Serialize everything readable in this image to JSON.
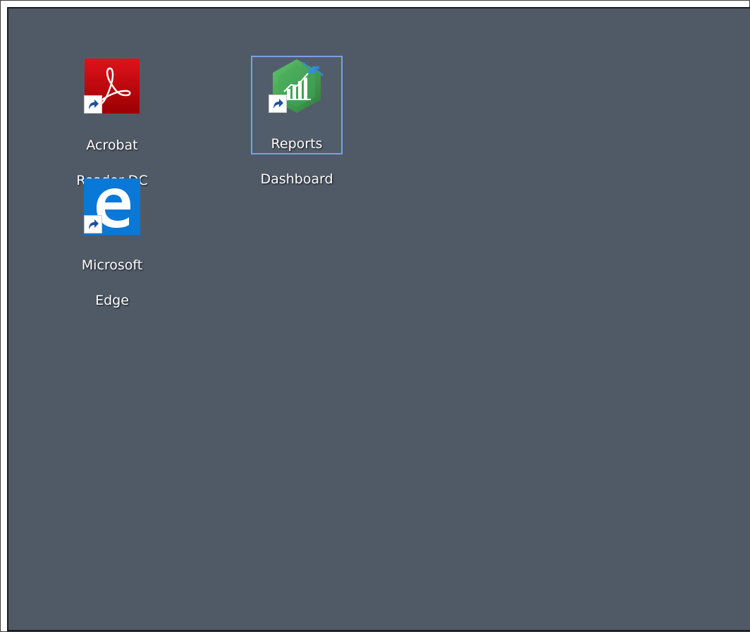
{
  "desktop": {
    "background_color": "#505a67",
    "icons": [
      {
        "name": "Acrobat Reader DC",
        "line1": "Acrobat",
        "line2": "Reader DC",
        "icon": "acrobat-reader-icon",
        "color": "#c00000",
        "selected": false
      },
      {
        "name": "Reports Dashboard",
        "line1": "Reports",
        "line2": "Dashboard",
        "icon": "reports-dashboard-icon",
        "color": "#3a9a4a",
        "selected": true
      },
      {
        "name": "Microsoft Edge",
        "line1": "Microsoft",
        "line2": "Edge",
        "icon": "edge-icon",
        "color": "#0a78d7",
        "selected": false
      }
    ],
    "shortcut_overlay_icon": "shortcut-arrow-icon"
  }
}
